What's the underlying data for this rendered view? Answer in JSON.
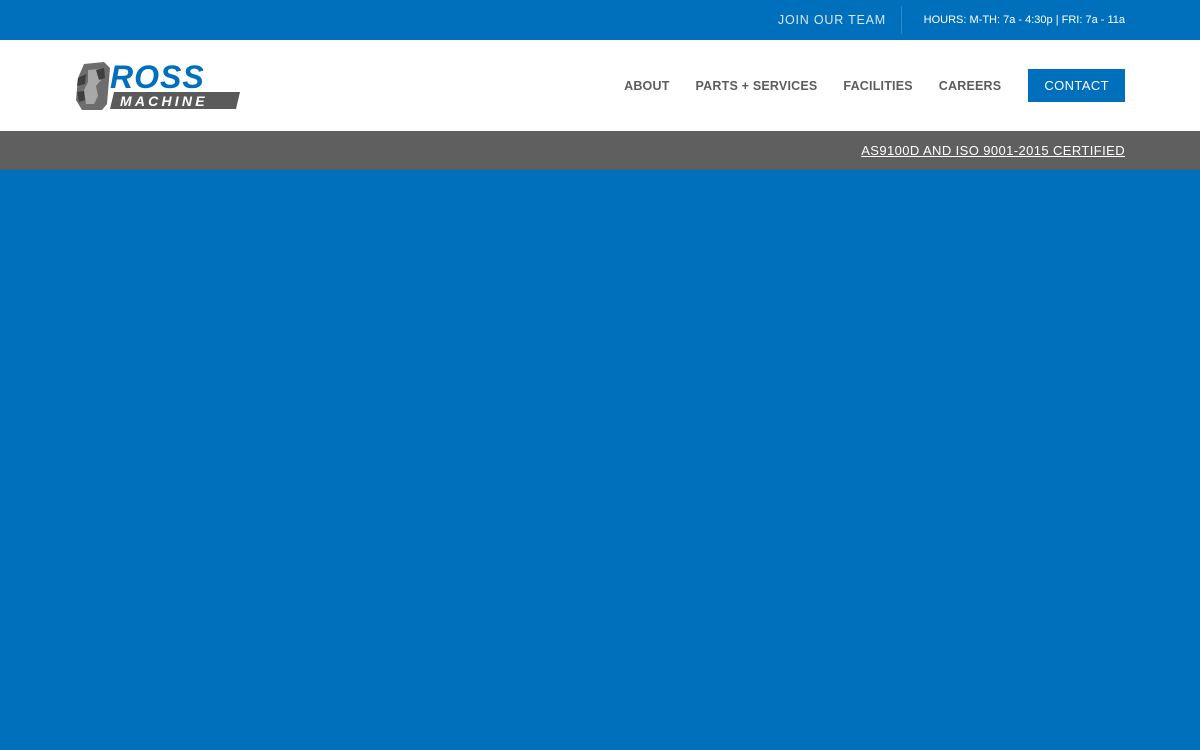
{
  "topbar": {
    "join_label": "JOIN OUR TEAM",
    "hours": "HOURS: M-TH: 7a - 4:30p | FRI: 7a - 11a"
  },
  "logo": {
    "word1": "ROSS",
    "word2": "MACHINE"
  },
  "nav": {
    "items": [
      "ABOUT",
      "PARTS + SERVICES",
      "FACILITIES",
      "CAREERS"
    ],
    "contact_label": "CONTACT"
  },
  "certbar": {
    "label": "AS9100D AND ISO 9001-2015 CERTIFIED"
  },
  "colors": {
    "brand_blue": "#0070bc",
    "cert_gray": "#5f5f5f",
    "nav_text": "#5d5d5d"
  }
}
